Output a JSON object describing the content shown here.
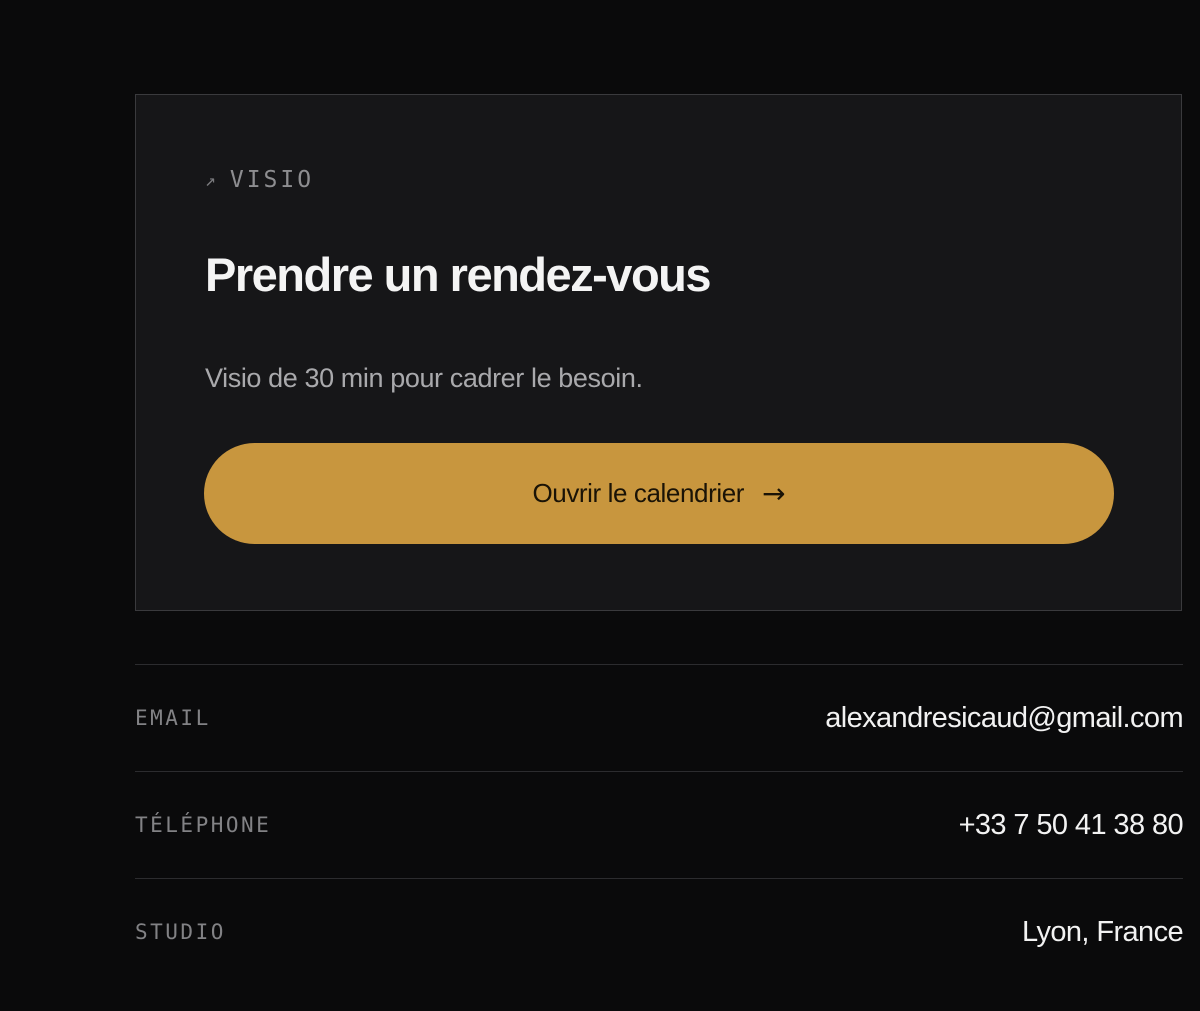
{
  "booking_card": {
    "eyebrow_icon": "arrow-up-right-icon",
    "eyebrow_arrow": "↗",
    "eyebrow": "VISIO",
    "title": "Prendre un rendez-vous",
    "description": "Visio de 30 min pour cadrer le besoin.",
    "cta_label": "Ouvrir le calendrier",
    "cta_arrow": "→"
  },
  "contact": {
    "email_label": "EMAIL",
    "email_value": "alexandresicaud@gmail.com",
    "phone_label": "TÉLÉPHONE",
    "phone_value": "+33 7 50 41 38 80",
    "studio_label": "STUDIO",
    "studio_value": "Lyon, France"
  },
  "colors": {
    "background": "#0a0a0b",
    "card": "#161618",
    "accent": "#c8963e"
  }
}
